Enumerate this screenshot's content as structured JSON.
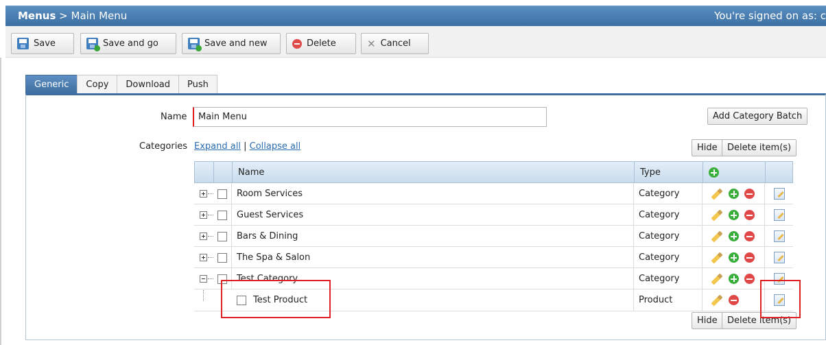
{
  "header": {
    "crumb_root": "Menus",
    "crumb_sep": " > ",
    "crumb_page": "Main Menu",
    "signed_on": "You're signed on as: c"
  },
  "toolbar": {
    "save": "Save",
    "save_and_go": "Save and go",
    "save_and_new": "Save and new",
    "delete": "Delete",
    "cancel": "Cancel"
  },
  "tabs": [
    "Generic",
    "Copy",
    "Download",
    "Push"
  ],
  "form": {
    "name_label": "Name",
    "name_value": "Main Menu",
    "add_category_batch": "Add Category Batch",
    "categories_label": "Categories",
    "expand_all": "Expand all",
    "separator": "|",
    "collapse_all": "Collapse all",
    "hide": "Hide",
    "delete_items": "Delete item(s)"
  },
  "grid": {
    "columns": {
      "name": "Name",
      "type": "Type"
    },
    "rows": [
      {
        "name": "Room Services",
        "type": "Category"
      },
      {
        "name": "Guest Services",
        "type": "Category"
      },
      {
        "name": "Bars & Dining",
        "type": "Category"
      },
      {
        "name": "The Spa & Salon",
        "type": "Category"
      },
      {
        "name": "Test Category",
        "type": "Category"
      },
      {
        "name": "Test Product",
        "type": "Product"
      }
    ]
  },
  "colors": {
    "titlebar": "#3c6fa3",
    "highlight_box": "#e02020",
    "required_marker": "#e02020"
  }
}
